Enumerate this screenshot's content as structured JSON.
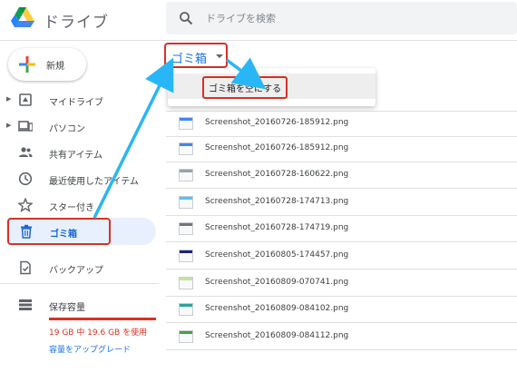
{
  "header": {
    "app_title": "ドライブ",
    "search_placeholder": "ドライブを検索"
  },
  "new_button": {
    "label": "新規"
  },
  "sidebar": {
    "items": [
      {
        "label": "マイドライブ",
        "icon": "my-drive-icon",
        "expandable": true
      },
      {
        "label": "パソコン",
        "icon": "computer-icon",
        "expandable": true
      },
      {
        "label": "共有アイテム",
        "icon": "shared-people-icon",
        "expandable": false
      },
      {
        "label": "最近使用したアイテム",
        "icon": "clock-icon",
        "expandable": false
      },
      {
        "label": "スター付き",
        "icon": "star-icon",
        "expandable": false
      },
      {
        "label": "ゴミ箱",
        "icon": "trash-icon",
        "expandable": false,
        "active": true
      },
      {
        "label": "バックアップ",
        "icon": "backup-icon",
        "expandable": false
      }
    ],
    "storage": {
      "label": "保存容量",
      "usage_text": "19 GB 中 19.6 GB を使用",
      "upgrade_label": "容量をアップグレード"
    }
  },
  "main": {
    "breadcrumb_label": "ゴミ箱",
    "menu": {
      "empty_trash_label": "ゴミ箱を空にする"
    },
    "files": [
      {
        "name": "Screenshot_20160726-185912.png",
        "thumb_accent": "#4285f4"
      },
      {
        "name": "Screenshot_20160726-185912.png",
        "thumb_accent": "#4285f4"
      },
      {
        "name": "Screenshot_20160726-185912.png",
        "thumb_accent": "#4285f4"
      },
      {
        "name": "Screenshot_20160728-160622.png",
        "thumb_accent": "#9aa0a6"
      },
      {
        "name": "Screenshot_20160728-174713.png",
        "thumb_accent": "#4fc3f7"
      },
      {
        "name": "Screenshot_20160728-174719.png",
        "thumb_accent": "#757575"
      },
      {
        "name": "Screenshot_20160805-174457.png",
        "thumb_accent": "#1a237e"
      },
      {
        "name": "Screenshot_20160809-070741.png",
        "thumb_accent": "#c5e1a5"
      },
      {
        "name": "Screenshot_20160809-084102.png",
        "thumb_accent": "#26a69a"
      },
      {
        "name": "Screenshot_20160809-084112.png",
        "thumb_accent": "#43a047"
      }
    ]
  },
  "colors": {
    "highlight_red": "#d93025",
    "arrow_blue": "#29b6f6",
    "link_blue": "#1a73e8"
  }
}
